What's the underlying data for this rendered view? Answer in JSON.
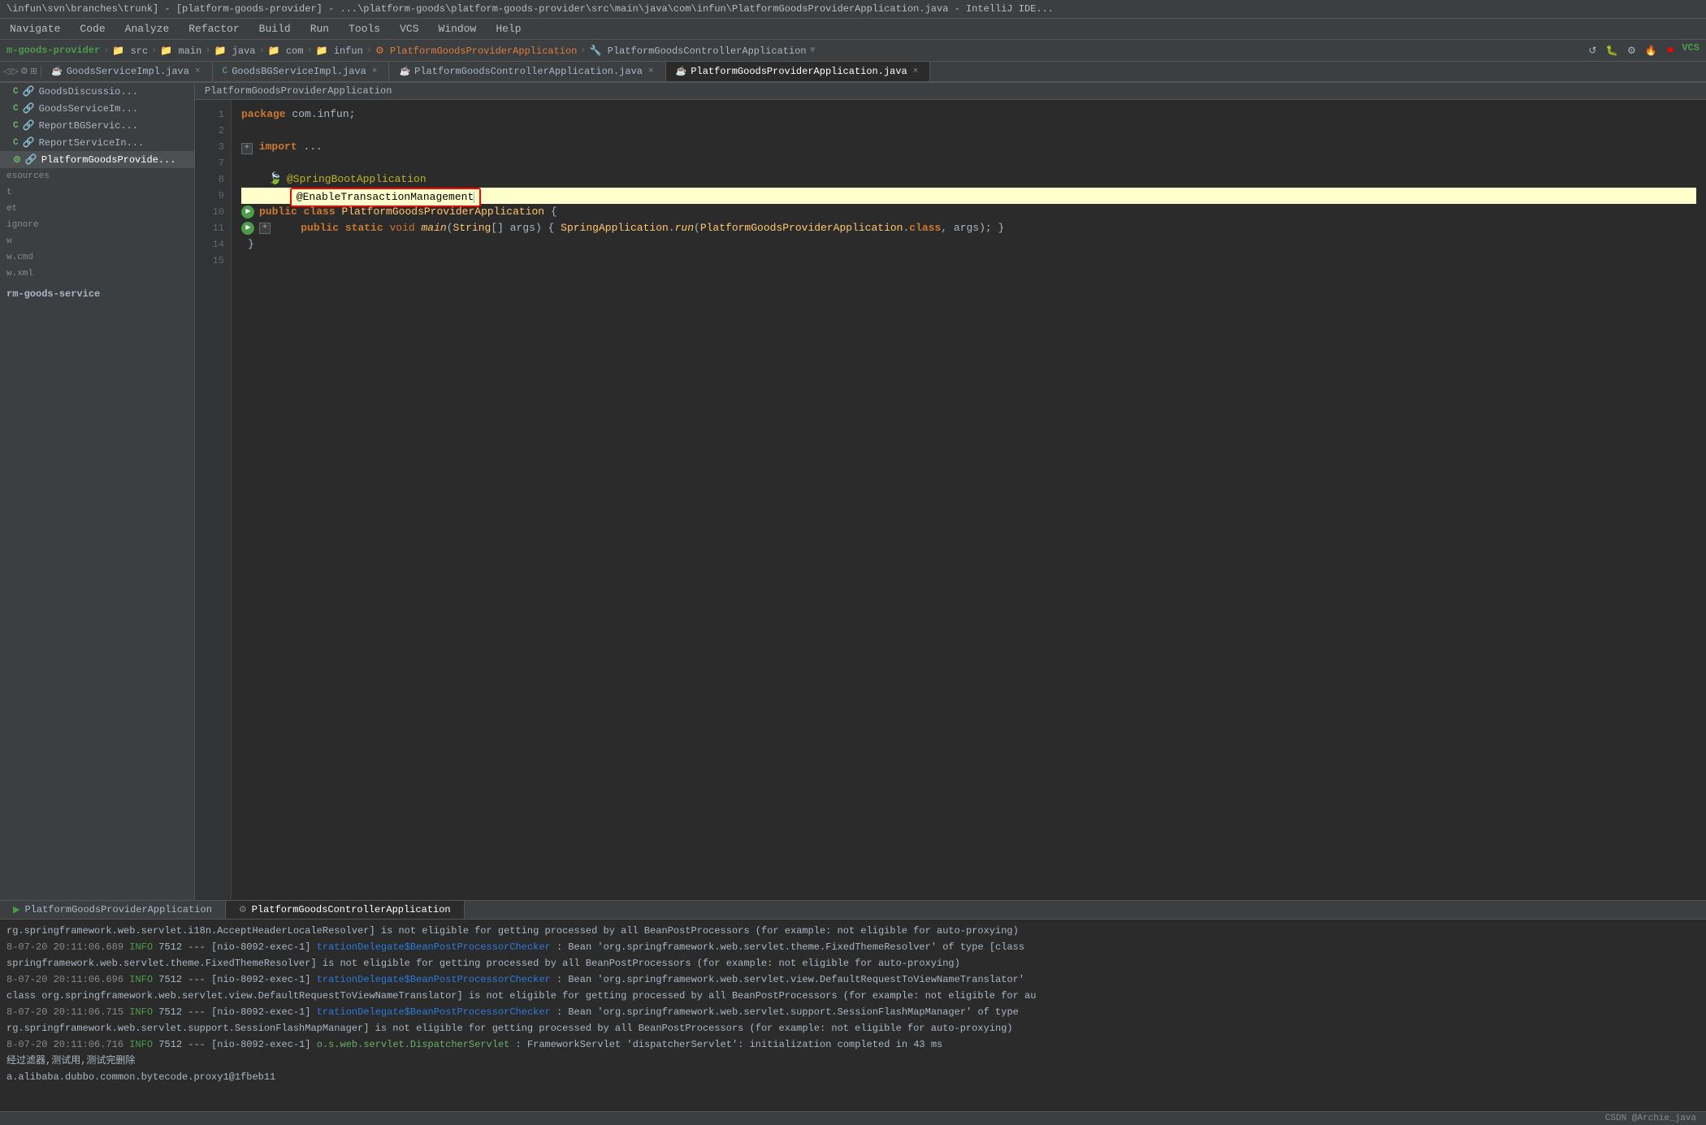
{
  "titleBar": {
    "text": "\\infun\\svn\\branches\\trunk] - [platform-goods-provider] - ...\\platform-goods\\platform-goods-provider\\src\\main\\java\\com\\infun\\PlatformGoodsProviderApplication.java - IntelliJ IDE..."
  },
  "menuBar": {
    "items": [
      "Navigate",
      "Code",
      "Analyze",
      "Refactor",
      "Build",
      "Run",
      "Tools",
      "VCS",
      "Window",
      "Help"
    ]
  },
  "breadcrumb": {
    "items": [
      "m-goods-provider",
      "src",
      "main",
      "java",
      "com",
      "infun",
      "PlatformGoodsProviderApplication",
      "PlatformGoodsControllerApplication"
    ]
  },
  "tabs": [
    {
      "label": "GoodsServiceImpl.java",
      "type": "java",
      "active": false
    },
    {
      "label": "GoodsBGServiceImpl.java",
      "type": "java",
      "active": false
    },
    {
      "label": "PlatformGoodsControllerApplication.java",
      "type": "java",
      "active": false
    },
    {
      "label": "PlatformGoodsProviderApplication.java",
      "type": "java",
      "active": true
    }
  ],
  "sidebar": {
    "items": [
      {
        "label": "GoodsDiscussio...",
        "type": "c"
      },
      {
        "label": "GoodsServiceIm...",
        "type": "c"
      },
      {
        "label": "ReportBGServic...",
        "type": "c"
      },
      {
        "label": "ReportServiceIn...",
        "type": "c"
      },
      {
        "label": "PlatformGoodsProvide...",
        "type": "platform",
        "active": true
      }
    ],
    "sections": [
      "esources",
      "t",
      "et",
      "ignore",
      "w",
      "w.cmd",
      "w.xml",
      "rm-goods-service"
    ]
  },
  "fileLabel": "PlatformGoodsProviderApplication",
  "codeLines": [
    {
      "num": 1,
      "text": "package com.infun;"
    },
    {
      "num": 2,
      "text": ""
    },
    {
      "num": 3,
      "text": "+ import ..."
    },
    {
      "num": 7,
      "text": ""
    },
    {
      "num": 8,
      "text": "@SpringBootApplication",
      "annotation": true
    },
    {
      "num": 9,
      "text": "@EnableTransactionManagement",
      "highlighted": true
    },
    {
      "num": 10,
      "text": "public class PlatformGoodsProviderApplication {",
      "hasRun": true
    },
    {
      "num": 11,
      "text": "    public static void main(String[] args) { SpringApplication.run(PlatformGoodsProviderApplication.class, args); }",
      "hasRun": true
    },
    {
      "num": 14,
      "text": "}"
    },
    {
      "num": 15,
      "text": ""
    }
  ],
  "runPanel": {
    "tabs": [
      {
        "label": "PlatformGoodsProviderApplication",
        "active": false
      },
      {
        "label": "PlatformGoodsControllerApplication",
        "active": true
      }
    ],
    "logs": [
      {
        "text": "rg.springframework.web.servlet.i18n.AcceptHeaderLocaleResolver] is not eligible for getting processed by all BeanPostProcessors (for example: not eligible for auto-proxying)"
      },
      {
        "date": "8-07-20",
        "time": "20:11:06.689",
        "level": "INFO",
        "pid": "7512",
        "thread": "[nio-8092-exec-1]",
        "class": "trationDelegate$BeanPostProcessorChecker",
        "msg": ": Bean 'org.springframework.web.servlet.theme.FixedThemeResolver' of type [class"
      },
      {
        "text": "springframework.web.servlet.theme.FixedThemeResolver] is not eligible for getting processed by all BeanPostProcessors (for example: not eligible for auto-proxying)"
      },
      {
        "date": "8-07-20",
        "time": "20:11:06.696",
        "level": "INFO",
        "pid": "7512",
        "thread": "[nio-8092-exec-1]",
        "class": "trationDelegate$BeanPostProcessorChecker",
        "msg": ": Bean 'org.springframework.web.servlet.view.DefaultRequestToViewNameTranslator'"
      },
      {
        "text": "class org.springframework.web.servlet.view.DefaultRequestToViewNameTranslator] is not eligible for getting processed by all BeanPostProcessors (for example: not eligible for au"
      },
      {
        "date": "8-07-20",
        "time": "20:11:06.715",
        "level": "INFO",
        "pid": "7512",
        "thread": "[nio-8092-exec-1]",
        "class": "trationDelegate$BeanPostProcessorChecker",
        "msg": ": Bean 'org.springframework.web.servlet.support.SessionFlashMapManager' of type"
      },
      {
        "text": "rg.springframework.web.servlet.support.SessionFlashMapManager] is not eligible for getting processed by all BeanPostProcessors (for example: not eligible for auto-proxying)"
      },
      {
        "date": "8-07-20",
        "time": "20:11:06.716",
        "level": "INFO",
        "pid": "7512",
        "thread": "[nio-8092-exec-1]",
        "class2": "o.s.web.servlet.DispatcherServlet",
        "msg2": ": FrameworkServlet 'dispatcherServlet': initialization completed in 43 ms"
      },
      {
        "text": "经过滤器,测试用,测试完删除",
        "chinese": true
      },
      {
        "text": "a.alibaba.dubbo.common.bytecode.proxy1@1fbeb11"
      }
    ]
  },
  "statusBar": {
    "csdn": "CSDN @Archie_java"
  }
}
